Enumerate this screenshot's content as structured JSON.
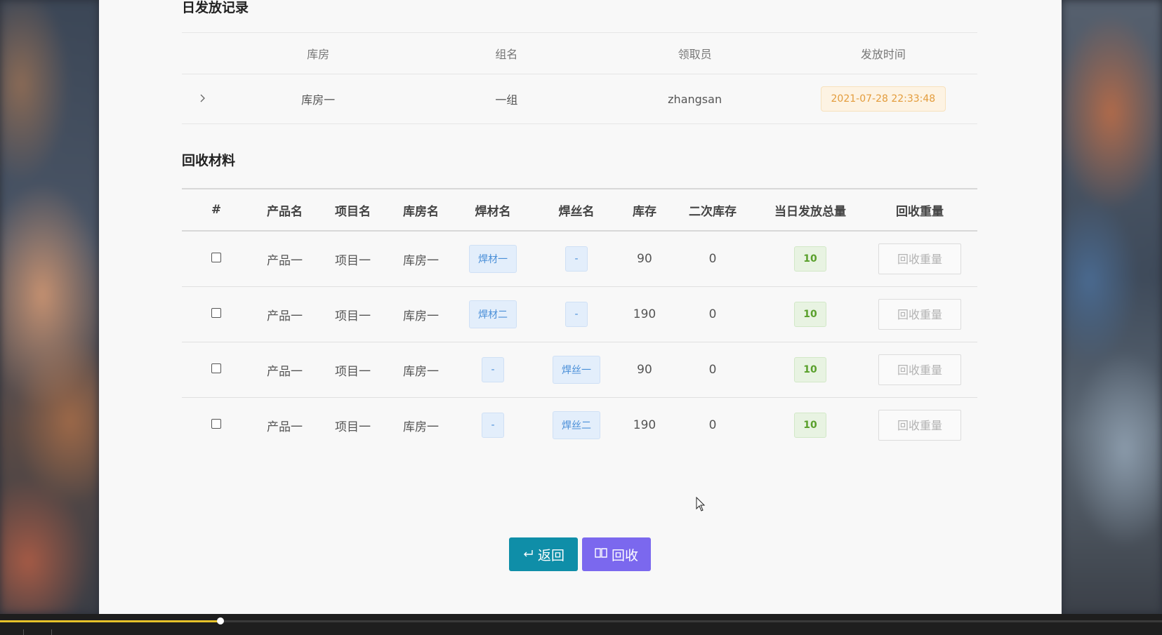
{
  "issue_section": {
    "title": "日发放记录",
    "headers": [
      "库房",
      "组名",
      "领取员",
      "发放时间"
    ],
    "rows": [
      {
        "warehouse": "库房一",
        "group": "一组",
        "receiver": "zhangsan",
        "time": "2021-07-28 22:33:48"
      }
    ]
  },
  "recycle_section": {
    "title": "回收材料",
    "headers": [
      "#",
      "产品名",
      "项目名",
      "库房名",
      "焊材名",
      "焊丝名",
      "库存",
      "二次库存",
      "当日发放总量",
      "回收重量"
    ],
    "rows": [
      {
        "product": "产品一",
        "project": "项目一",
        "warehouse": "库房一",
        "material": "焊材一",
        "wire": "-",
        "stock": "90",
        "second_stock": "0",
        "daily_total": "10",
        "weight_placeholder": "回收重量"
      },
      {
        "product": "产品一",
        "project": "项目一",
        "warehouse": "库房一",
        "material": "焊材二",
        "wire": "-",
        "stock": "190",
        "second_stock": "0",
        "daily_total": "10",
        "weight_placeholder": "回收重量"
      },
      {
        "product": "产品一",
        "project": "项目一",
        "warehouse": "库房一",
        "material": "-",
        "wire": "焊丝一",
        "stock": "90",
        "second_stock": "0",
        "daily_total": "10",
        "weight_placeholder": "回收重量"
      },
      {
        "product": "产品一",
        "project": "项目一",
        "warehouse": "库房一",
        "material": "-",
        "wire": "焊丝二",
        "stock": "190",
        "second_stock": "0",
        "daily_total": "10",
        "weight_placeholder": "回收重量"
      }
    ]
  },
  "actions": {
    "back_label": "返回",
    "back_icon": "return-icon",
    "recycle_label": "回收",
    "recycle_icon": "book-icon"
  },
  "player": {
    "progress": 0.19
  },
  "colors": {
    "panel_bg": "#f8f8f8",
    "back_button": "#0f8ea8",
    "recycle_button": "#7b68ee",
    "time_tag": "#e39c3c",
    "material_tag": "#4a8fd8",
    "total_tag": "#5aa02c",
    "progress": "#e6c22a"
  }
}
